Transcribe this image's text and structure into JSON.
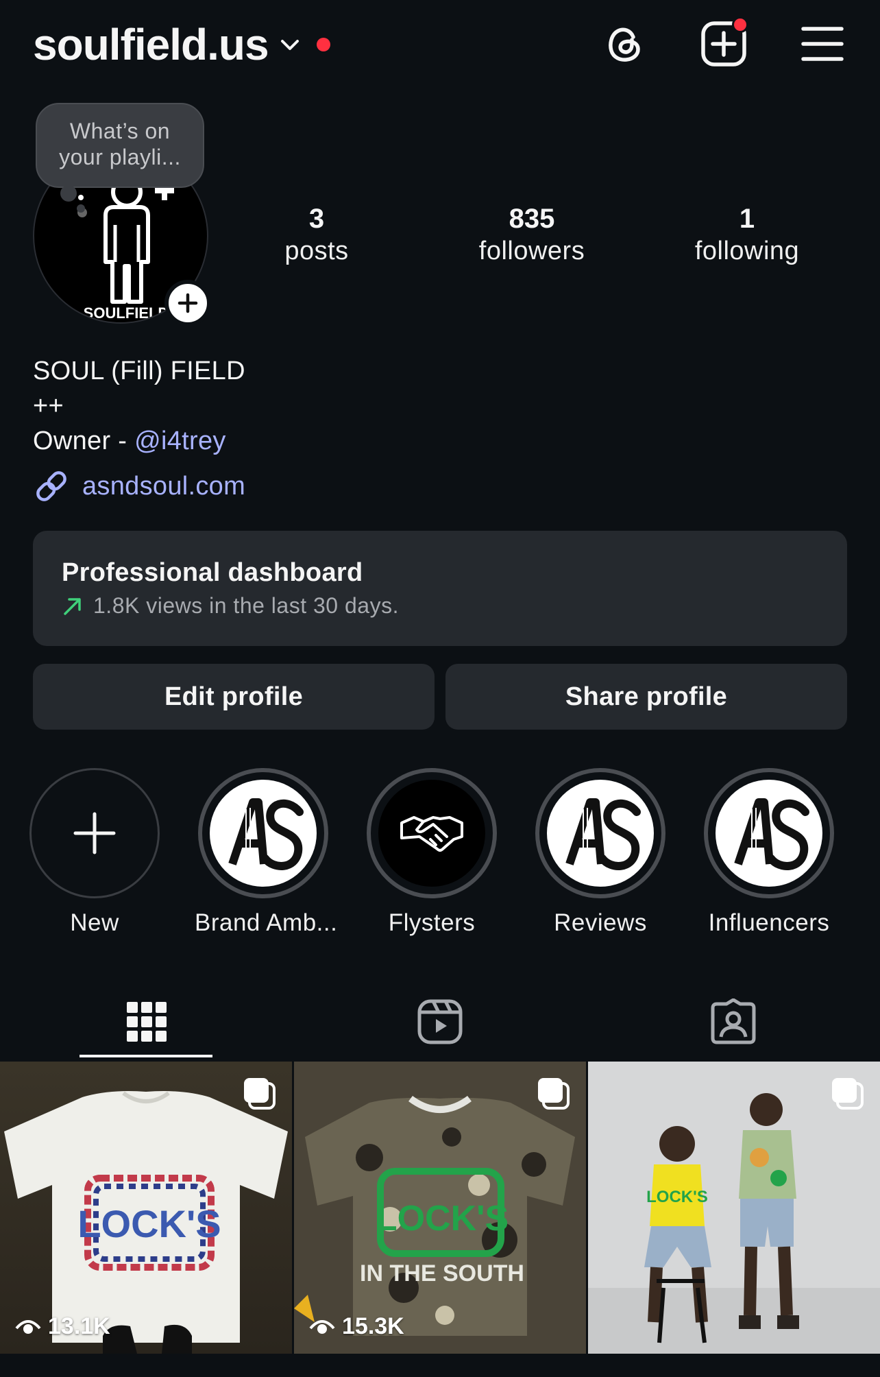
{
  "header": {
    "username": "soulfield.us",
    "icons": [
      "threads-icon",
      "create-post-icon",
      "menu-icon"
    ]
  },
  "note": {
    "text": "What’s on your playli..."
  },
  "avatar": {
    "caption": "SOULFIELD"
  },
  "stats": [
    {
      "value": "3",
      "label": "posts"
    },
    {
      "value": "835",
      "label": "followers"
    },
    {
      "value": "1",
      "label": "following"
    }
  ],
  "bio": {
    "name": "SOUL (Fill) FIELD",
    "line2": "++",
    "owner_prefix": "Owner - ",
    "owner_mention": "@i4trey",
    "link": "asndsoul.com"
  },
  "dashboard": {
    "title": "Professional dashboard",
    "subtitle": "1.8K views in the last 30 days."
  },
  "buttons": {
    "edit": "Edit profile",
    "share": "Share profile"
  },
  "highlights": [
    {
      "label": "New"
    },
    {
      "label": "Brand Amb..."
    },
    {
      "label": "Flysters"
    },
    {
      "label": "Reviews"
    },
    {
      "label": "Influencers"
    }
  ],
  "tabs": [
    "grid-icon",
    "reels-icon",
    "tagged-icon"
  ],
  "posts": [
    {
      "views": "13.1K",
      "overlay_text": "LOCK'S"
    },
    {
      "views": "15.3K",
      "overlay_text": "LOCK'S",
      "overlay_text2": "IN THE SOUTH"
    },
    {
      "views": "",
      "overlay_text": "LOCK'S"
    }
  ],
  "colors": {
    "background": "#0c1014",
    "surface": "#25292e",
    "link": "#a8b2ff",
    "notification": "#ff3040",
    "trend": "#3fd07a"
  }
}
